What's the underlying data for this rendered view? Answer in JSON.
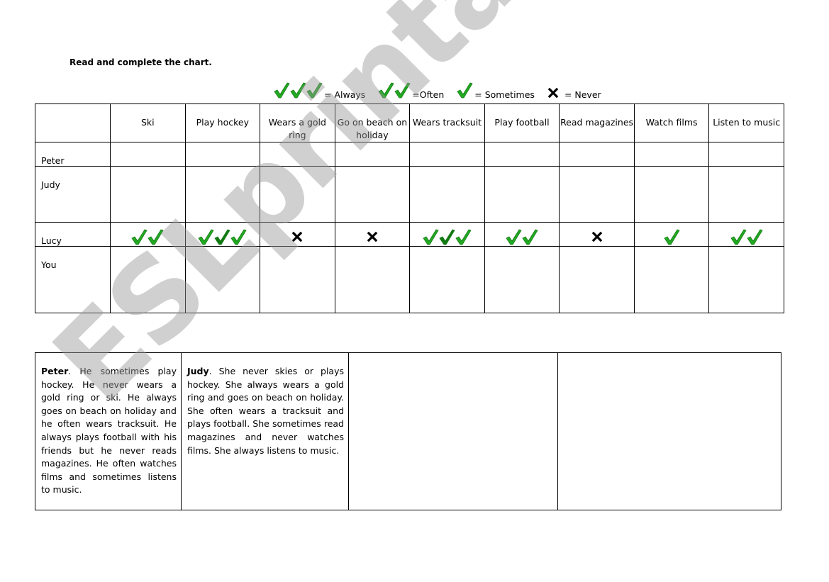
{
  "instruction": "Read and complete the chart.",
  "legend": [
    {
      "symbol": "check",
      "count": 3,
      "label": "= Always"
    },
    {
      "symbol": "check",
      "count": 2,
      "label": "=Often"
    },
    {
      "symbol": "check",
      "count": 1,
      "label": "= Sometimes"
    },
    {
      "symbol": "cross",
      "count": 1,
      "label": "= Never"
    }
  ],
  "colors": {
    "check": "#22aa22",
    "check_dark": "#137a13",
    "cross": "#000000",
    "border": "#000000"
  },
  "chart": {
    "columns": [
      "Ski",
      "Play hockey",
      "Wears a gold ring",
      "Go on beach on holiday",
      "Wears tracksuit",
      "Play football",
      "Read magazines",
      "Watch films",
      "Listen to music"
    ],
    "rows": [
      {
        "name": "Peter",
        "values": [
          "",
          "",
          "",
          "",
          "",
          "",
          "",
          "",
          ""
        ]
      },
      {
        "name": "Judy",
        "values": [
          "",
          "",
          "",
          "",
          "",
          "",
          "",
          "",
          ""
        ]
      },
      {
        "name": "Lucy",
        "values": [
          "often",
          "always",
          "never",
          "never",
          "always",
          "often",
          "never",
          "sometimes",
          "often"
        ]
      },
      {
        "name": "You",
        "values": [
          "",
          "",
          "",
          "",
          "",
          "",
          "",
          "",
          ""
        ]
      }
    ]
  },
  "texts": [
    {
      "name": "Peter",
      "body": ". He sometimes play hockey. He never wears a gold ring or ski. He always goes on beach on holiday and he often wears tracksuit. He always plays football with his friends but he never reads magazines. He often watches films and sometimes listens to music."
    },
    {
      "name": "Judy",
      "body": ". She never skies or plays hockey. She always wears a gold ring and goes on beach on holiday. She often wears a tracksuit and plays football. She sometimes read magazines and never watches films. She always listens to music."
    },
    {
      "name": "",
      "body": ""
    },
    {
      "name": "",
      "body": ""
    }
  ],
  "watermark": "ESLprintables.com"
}
